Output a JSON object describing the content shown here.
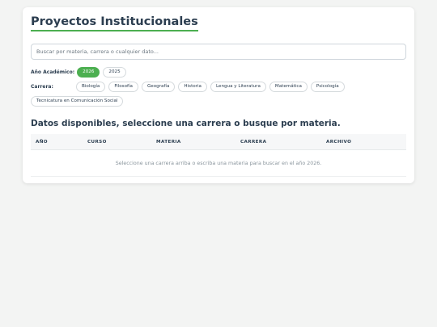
{
  "header": {
    "title": "Proyectos Institucionales"
  },
  "search": {
    "placeholder": "Buscar por materia, carrera o cualquier dato...",
    "value": ""
  },
  "filters": {
    "year_label": "Año Académico:",
    "years": [
      {
        "label": "2026",
        "active": true
      },
      {
        "label": "2025",
        "active": false
      }
    ],
    "career_label": "Carrera:",
    "careers": [
      "Biología",
      "Filosofía",
      "Geografía",
      "Historia",
      "Lengua y Literatura",
      "Matemática",
      "Psicología",
      "Tecnicatura en Comunicación Social"
    ]
  },
  "results": {
    "title": "Datos disponibles, seleccione una carrera o busque por materia.",
    "columns": [
      "AÑO",
      "CURSO",
      "MATERIA",
      "CARRERA",
      "ARCHIVO"
    ],
    "empty_message": "Seleccione una carrera arriba o escriba una materia para buscar en el año 2026."
  },
  "colors": {
    "accent": "#4caf50",
    "text": "#2c3e50",
    "background": "#f3f4f3"
  }
}
